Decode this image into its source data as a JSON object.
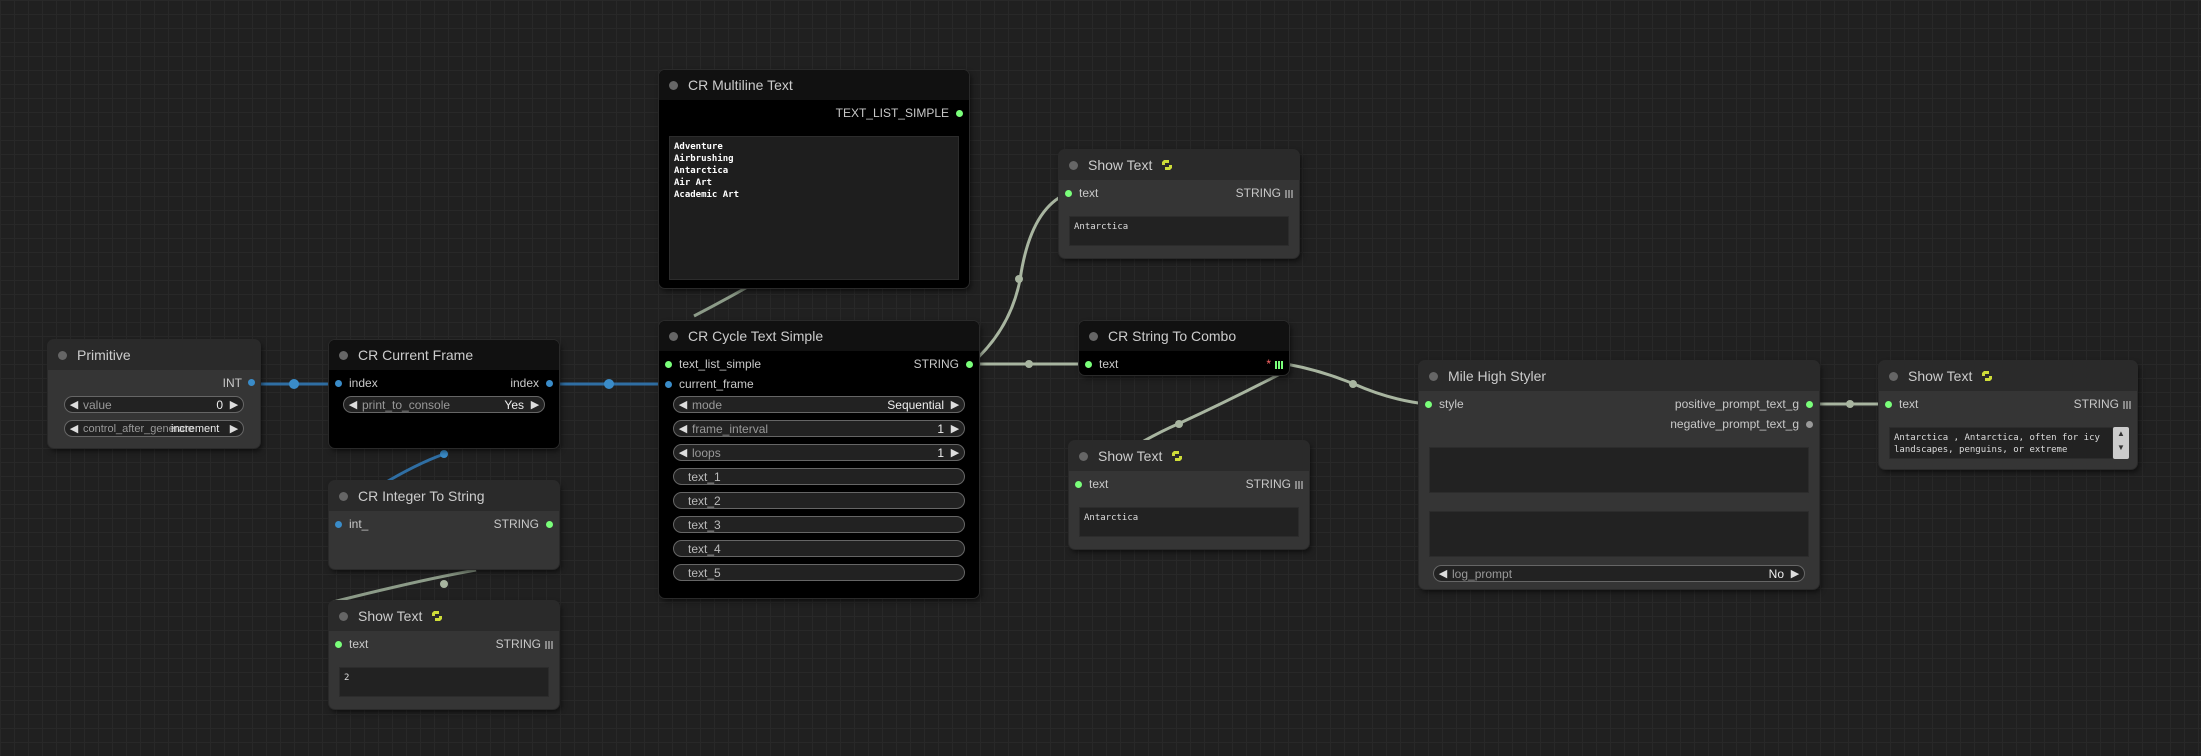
{
  "canvas": {
    "background": "#202020",
    "grid": "#282828"
  },
  "nodes": {
    "primitive": {
      "title": "Primitive",
      "output": "INT",
      "value_label": "value",
      "value": "0",
      "control_label": "control_after_generate",
      "control_value": "increment"
    },
    "current_frame": {
      "title": "CR Current Frame",
      "input": "index",
      "output": "index",
      "print_label": "print_to_console",
      "print_value": "Yes"
    },
    "int_to_string": {
      "title": "CR Integer To String",
      "input": "int_",
      "output": "STRING"
    },
    "show_text_bottom": {
      "title": "Show Text",
      "input": "text",
      "output": "STRING",
      "content": "2"
    },
    "multiline": {
      "title": "CR Multiline Text",
      "output": "TEXT_LIST_SIMPLE",
      "content": "Adventure\nAirbrushing\nAntarctica\nAir Art\nAcademic Art"
    },
    "cycle": {
      "title": "CR Cycle Text Simple",
      "input1": "text_list_simple",
      "input2": "current_frame",
      "output": "STRING",
      "mode_label": "mode",
      "mode_value": "Sequential",
      "frame_interval_label": "frame_interval",
      "frame_interval_value": "1",
      "loops_label": "loops",
      "loops_value": "1",
      "texts": [
        "text_1",
        "text_2",
        "text_3",
        "text_4",
        "text_5"
      ]
    },
    "show_text_top": {
      "title": "Show Text",
      "input": "text",
      "output": "STRING",
      "content": "Antarctica"
    },
    "string_to_combo": {
      "title": "CR String To Combo",
      "input": "text",
      "output": "*"
    },
    "show_text_mid": {
      "title": "Show Text",
      "input": "text",
      "output": "STRING",
      "content": "Antarctica"
    },
    "styler": {
      "title": "Mile High Styler",
      "input": "style",
      "output1": "positive_prompt_text_g",
      "output2": "negative_prompt_text_g",
      "log_label": "log_prompt",
      "log_value": "No"
    },
    "show_text_right": {
      "title": "Show Text",
      "input": "text",
      "output": "STRING",
      "content": "Antarctica , Antarctica, often for icy landscapes, penguins, or extreme"
    }
  },
  "icons": {
    "python": "python-icon"
  },
  "colors": {
    "int_link": "#3a8cc9",
    "string_link": "#a8b5a0",
    "slot_green": "#7aff7a"
  }
}
